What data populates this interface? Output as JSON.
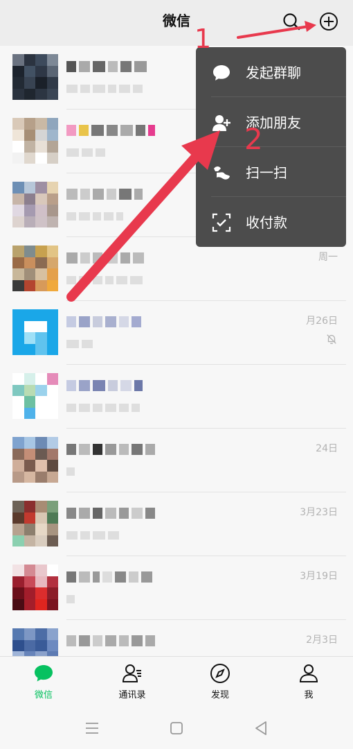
{
  "header": {
    "title": "微信"
  },
  "popup_menu": {
    "items": [
      {
        "label": "发起群聊",
        "icon": "chat-bubble-icon"
      },
      {
        "label": "添加朋友",
        "icon": "add-friend-icon"
      },
      {
        "label": "扫一扫",
        "icon": "scan-icon"
      },
      {
        "label": "收付款",
        "icon": "payment-icon"
      }
    ]
  },
  "chats": [
    {
      "time": ""
    },
    {
      "time": ""
    },
    {
      "time": ""
    },
    {
      "time": "周一"
    },
    {
      "time": "月26日"
    },
    {
      "time": ""
    },
    {
      "time": "24日"
    },
    {
      "time": "3月23日"
    },
    {
      "time": "3月19日"
    },
    {
      "time": "2月3日"
    }
  ],
  "tabs": [
    {
      "label": "微信",
      "icon": "chats-icon",
      "active": true
    },
    {
      "label": "通讯录",
      "icon": "contacts-icon",
      "active": false
    },
    {
      "label": "发现",
      "icon": "discover-icon",
      "active": false
    },
    {
      "label": "我",
      "icon": "me-icon",
      "active": false
    }
  ],
  "annotations": {
    "step1": "1",
    "step2": "2",
    "color": "#e8394d"
  },
  "colors": {
    "accent": "#07c160",
    "popup_bg": "#4c4c4c",
    "background": "#ededed"
  }
}
